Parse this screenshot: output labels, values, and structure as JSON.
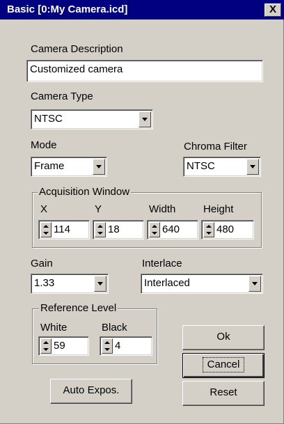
{
  "window": {
    "title": "Basic [0:My Camera.icd]",
    "close_label": "X"
  },
  "description": {
    "label": "Camera Description",
    "value": "Customized camera"
  },
  "camera_type": {
    "label": "Camera Type",
    "value": "NTSC"
  },
  "mode": {
    "label": "Mode",
    "value": "Frame"
  },
  "chroma_filter": {
    "label": "Chroma Filter",
    "value": "NTSC"
  },
  "acquisition": {
    "title": "Acquisition Window",
    "x": {
      "label": "X",
      "value": "114"
    },
    "y": {
      "label": "Y",
      "value": "18"
    },
    "width": {
      "label": "Width",
      "value": "640"
    },
    "height": {
      "label": "Height",
      "value": "480"
    }
  },
  "gain": {
    "label": "Gain",
    "value": "1.33"
  },
  "interlace": {
    "label": "Interlace",
    "value": "Interlaced"
  },
  "reference": {
    "title": "Reference Level",
    "white": {
      "label": "White",
      "value": "59"
    },
    "black": {
      "label": "Black",
      "value": "4"
    }
  },
  "buttons": {
    "ok": "Ok",
    "cancel": "Cancel",
    "reset": "Reset",
    "auto_expos": "Auto Expos."
  }
}
